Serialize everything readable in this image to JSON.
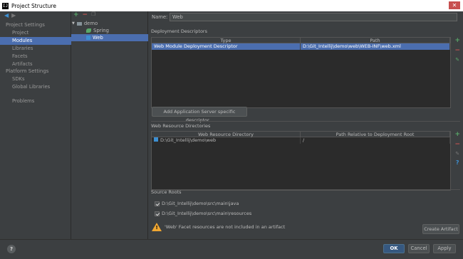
{
  "window": {
    "title": "Project Structure",
    "app_icon": "IJ",
    "close_glyph": "✕"
  },
  "nav": {
    "back_glyph": "◀",
    "forward_glyph": "▶",
    "project_settings_header": "Project Settings",
    "project_settings": [
      {
        "label": "Project"
      },
      {
        "label": "Modules"
      },
      {
        "label": "Libraries"
      },
      {
        "label": "Facets"
      },
      {
        "label": "Artifacts"
      }
    ],
    "platform_settings_header": "Platform Settings",
    "platform_settings": [
      {
        "label": "SDKs"
      },
      {
        "label": "Global Libraries"
      }
    ],
    "problems": "Problems"
  },
  "tree": {
    "add_glyph": "+",
    "remove_glyph": "−",
    "copy_glyph": "❐",
    "expand_glyph": "▼",
    "items": [
      {
        "label": "demo",
        "icon": "folder-icon"
      },
      {
        "label": "Spring",
        "icon": "spring-leaf-icon"
      },
      {
        "label": "Web",
        "icon": "web-facet-icon"
      }
    ]
  },
  "main": {
    "name_label": "Name:",
    "name_value": "Web",
    "deployment": {
      "title": "Deployment Descriptors",
      "columns": [
        "Type",
        "Path"
      ],
      "rows": [
        {
          "type": "Web Module Deployment Descriptor",
          "path": "D:\\Git_Intellij\\demo\\web\\WEB-INF\\web.xml"
        }
      ],
      "add_server_button": "Add Application Server specific descriptor..."
    },
    "resources": {
      "title": "Web Resource Directories",
      "columns": [
        "Web Resource Directory",
        "Path Relative to Deployment Root"
      ],
      "rows": [
        {
          "dir": "D:\\Git_Intellij\\demo\\web",
          "rel": "/"
        }
      ]
    },
    "source_roots": {
      "title": "Source Roots",
      "items": [
        {
          "path": "D:\\Git_Intellij\\demo\\src\\main\\java",
          "checked": true
        },
        {
          "path": "D:\\Git_Intellij\\demo\\src\\main\\resources",
          "checked": true
        }
      ]
    },
    "warning": {
      "message": "'Web' Facet resources are not included in an artifact",
      "warn_glyph": "!",
      "create_artifact_button": "Create Artifact"
    },
    "side_glyphs": {
      "add": "+",
      "remove": "−",
      "edit": "✎",
      "help": "?"
    }
  },
  "footer": {
    "help_glyph": "?",
    "ok": "OK",
    "cancel": "Cancel",
    "apply": "Apply"
  },
  "colors": {
    "background": "#3c3f41",
    "selection": "#4b6eaf",
    "add": "#59a869",
    "remove": "#c75450",
    "warning": "#f0a732",
    "ok_button": "#365880"
  }
}
